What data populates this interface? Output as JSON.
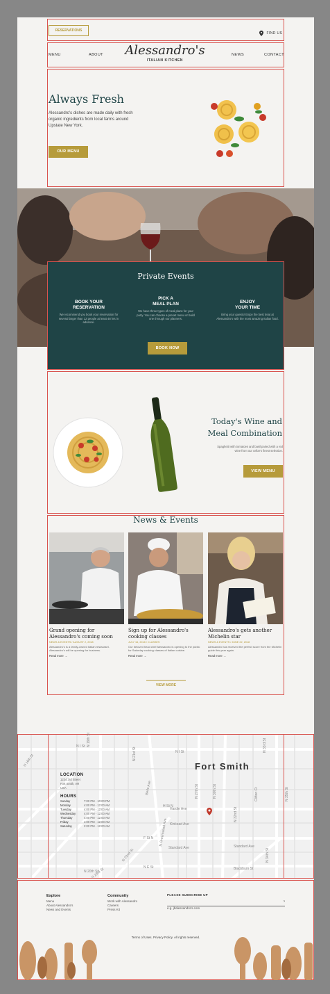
{
  "header": {
    "reservations_label": "RESERVATIONS",
    "find_us_label": "FIND US",
    "nav_left": [
      "MENU",
      "ABOUT"
    ],
    "nav_right": [
      "NEWS",
      "CONTACT"
    ],
    "logo_script": "Alessandro's",
    "logo_sub": "ITALIAN KITCHEN"
  },
  "hero": {
    "title": "Always Fresh",
    "body": "Alessandro's dishes are made daily with fresh organic ingredients from local farms around Upstate New York.",
    "button": "OUR MENU"
  },
  "private_events": {
    "title": "Private Events",
    "steps": [
      {
        "heading": "BOOK YOUR\nRESERVATION",
        "text": "We recommend you book your reservation for several larger than 12 people at least 48 hrs in advance."
      },
      {
        "heading": "PICK A\nMEAL PLAN",
        "text": "We have three types of meal plans for your party. You can choose a preset menu or build one through our planners."
      },
      {
        "heading": "ENJOY\nYOUR TIME",
        "text": "Bring your guests! Enjoy the best treat at Alessandro's with the most amazing Italian food."
      }
    ],
    "button": "BOOK NOW"
  },
  "wine": {
    "title_line1": "Today's Wine and",
    "title_line2": "Meal Combination",
    "text_line1": "Spaghetti with tomatoes and basil paired with a red",
    "text_line2": "wine from our cellar's finest selection.",
    "button": "VIEW MENU"
  },
  "news": {
    "title": "News & Events",
    "cards": [
      {
        "title": "Grand opening for Alessandro's coming soon",
        "meta": "NEWS & EVENTS / AUGUST 2, 2018",
        "body": "Alessandro's is a family-owned Italian restaurant. Alessandro's will be opening for business.",
        "link": "Read more →"
      },
      {
        "title": "Sign up for Alessandro's cooking classes",
        "meta": "JULY 16, 2018 / CLASSES",
        "body": "Our beloved head chef Alessandro is opening to the public for Saturday cooking classes of Italian cuisine.",
        "link": "Read more →"
      },
      {
        "title": "Alessandro's gets another Michelin star",
        "meta": "NEWS & EVENTS / JUNE 22, 2018",
        "body": "Alessandro has received the perfect score from the Michelin guide this year again.",
        "link": "Read more →"
      }
    ],
    "button": "VIEW MORE"
  },
  "map": {
    "city": "Fort Smith",
    "location_heading": "LOCATION",
    "address": [
      "1234 3rd Street",
      "Fort Smith, AR",
      "USA"
    ],
    "hours_heading": "HOURS",
    "hours": [
      {
        "day": "Sunday",
        "time": "7:00 PM - 10:00 PM"
      },
      {
        "day": "Monday",
        "time": "4:00 PM - 12:00 AM"
      },
      {
        "day": "Tuesday",
        "time": "4:00 PM - 12:00 AM"
      },
      {
        "day": "Wednesday",
        "time": "4:00 PM - 12:00 AM"
      },
      {
        "day": "Thursday",
        "time": "4:00 PM - 12:00 AM"
      },
      {
        "day": "Friday",
        "time": "4:00 PM - 12:00 AM"
      },
      {
        "day": "Saturday",
        "time": "2:00 PM - 12:00 AM"
      }
    ],
    "streets": {
      "n_st_1": "N I St",
      "n_st_2": "N I St",
      "n_h_st": "H St N",
      "n_f_st": "F St N",
      "n_e_st": "N E St",
      "n_19th": "N 19th St",
      "n_21st": "N 21st St",
      "belle": "Belle Ave",
      "greenwood": "N Greenwood Ave",
      "n_30th": "N 30th St",
      "hardie": "Hardie Ave",
      "kinkead": "Kinkead Ave",
      "standard": "Standard Ave",
      "standard2": "Standard Ave",
      "blackburn": "Blackburn St",
      "clifton": "Clifton Ct",
      "n_33rd": "N 33rd St",
      "n_35th": "N 35th St",
      "n_34th": "N 34th St",
      "n_27th": "N 27th St",
      "n_32nd": "N 32nd St",
      "n_16th": "N 16th St",
      "n_22nd": "N 22nd St",
      "n_23rd": "N 23rd St",
      "n_20th": "N 20th St"
    }
  },
  "footer": {
    "explore_heading": "Explore",
    "explore_links": [
      "Menu",
      "About Alessandro's",
      "News and Events"
    ],
    "community_heading": "Community",
    "community_links": [
      "Work with Alessandro",
      "Careers",
      "Press Kit"
    ],
    "newsletter_heading": "PLEASE SUBSCRIBE UP",
    "newsletter_placeholder": "e.g. jbalessandro's.com",
    "copyright": "Terms of Uses. Privacy Policy. All rights reserved."
  },
  "colors": {
    "gold": "#b69b3b",
    "teal": "#1f4446",
    "marker": "#c0392b"
  }
}
